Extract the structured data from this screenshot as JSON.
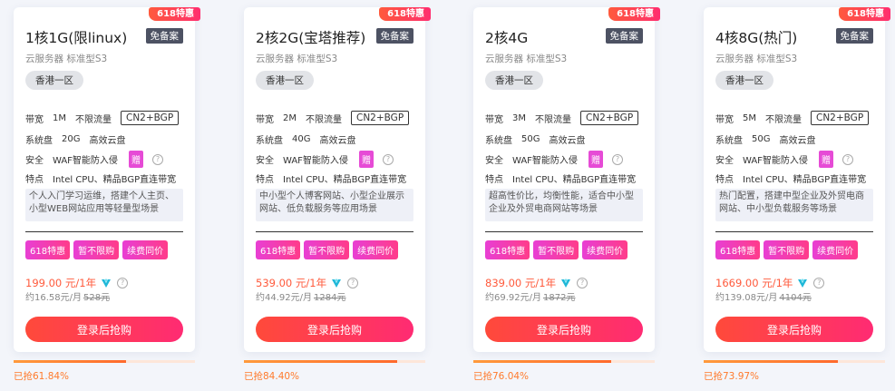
{
  "badge": "618特惠",
  "mianbei": "免备案",
  "subtitle": "云服务器 标准型S3",
  "region": "香港一区",
  "labels": {
    "bandwidth": "带宽",
    "unlimited": "不限流量",
    "line": "CN2+BGP",
    "disk": "系统盘",
    "disk_type": "高效云盘",
    "security": "安全",
    "waf": "WAF智能防入侵",
    "gift": "赠",
    "feature": "特点",
    "feature_val": "Intel CPU、精品BGP直连带宽"
  },
  "tags": [
    "618特惠",
    "暂不限购",
    "续费同价"
  ],
  "buy_label": "登录后抢购",
  "colors": {
    "accent": "#ff4a3a",
    "tag_pink": "#e83fd4",
    "progress": "#ff7a2c"
  },
  "cards": [
    {
      "title": "1核1G(限linux)",
      "bandwidth": "1M",
      "disk": "20G",
      "desc": "个人入门学习运维，搭建个人主页、小型WEB网站应用等轻量型场景",
      "price": "199.00 元/1年",
      "monthly": "约16.58元/月",
      "original": "528元",
      "sold_text": "已抢61.84%",
      "sold_pct": 61.84
    },
    {
      "title": "2核2G(宝塔推荐)",
      "bandwidth": "2M",
      "disk": "40G",
      "desc": "中小型个人博客网站、小型企业展示网站、低负载服务等应用场景",
      "price": "539.00 元/1年",
      "monthly": "约44.92元/月",
      "original": "1284元",
      "sold_text": "已抢84.40%",
      "sold_pct": 84.4
    },
    {
      "title": "2核4G",
      "bandwidth": "3M",
      "disk": "50G",
      "desc": "超高性价比，均衡性能，适合中小型企业及外贸电商网站等场景",
      "price": "839.00 元/1年",
      "monthly": "约69.92元/月",
      "original": "1872元",
      "sold_text": "已抢76.04%",
      "sold_pct": 76.04
    },
    {
      "title": "4核8G(热门)",
      "bandwidth": "5M",
      "disk": "50G",
      "desc": "热门配置，搭建中型企业及外贸电商网站、中小型负载服务等场景",
      "price": "1669.00 元/1年",
      "monthly": "约139.08元/月",
      "original": "4104元",
      "sold_text": "已抢73.97%",
      "sold_pct": 73.97
    }
  ]
}
